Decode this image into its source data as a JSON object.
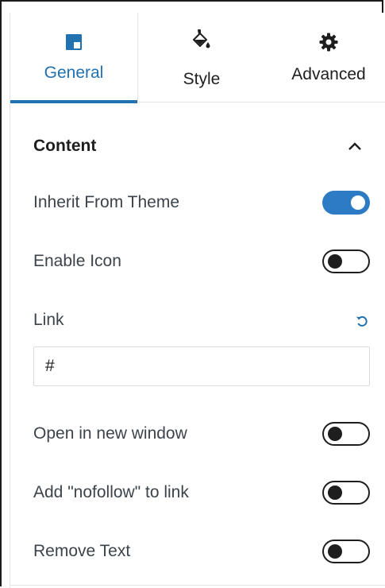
{
  "tabs": [
    {
      "label": "General",
      "icon": "layout-icon",
      "active": true
    },
    {
      "label": "Style",
      "icon": "paint-bucket-icon",
      "active": false
    },
    {
      "label": "Advanced",
      "icon": "gear-icon",
      "active": false
    }
  ],
  "section": {
    "title": "Content",
    "expanded": true
  },
  "settings": {
    "inherit_from_theme": {
      "label": "Inherit From Theme",
      "on": true
    },
    "enable_icon": {
      "label": "Enable Icon",
      "on": false
    },
    "link": {
      "label": "Link",
      "value": "#"
    },
    "open_new_window": {
      "label": "Open in new window",
      "on": false
    },
    "nofollow": {
      "label": "Add \"nofollow\" to link",
      "on": false
    },
    "remove_text": {
      "label": "Remove Text",
      "on": false
    }
  },
  "colors": {
    "accent": "#2271b1",
    "toggle_on": "#2c7bc4",
    "text": "#1e1e1e"
  }
}
